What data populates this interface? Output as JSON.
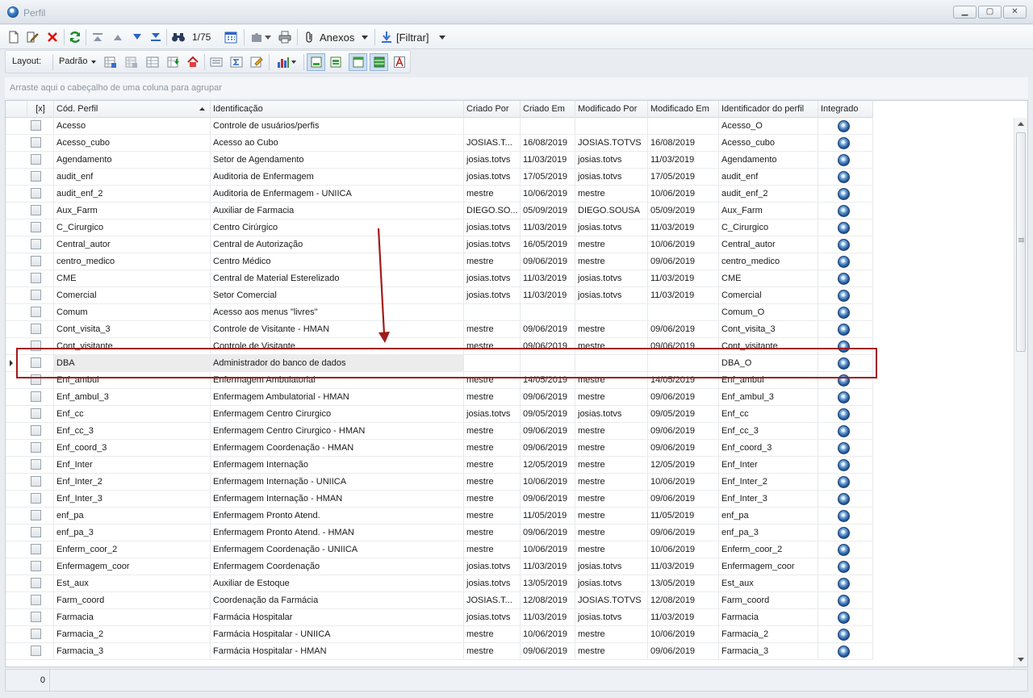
{
  "window": {
    "title": "Perfil",
    "minimize_label": "▁",
    "maximize_label": "▢",
    "close_label": "✕"
  },
  "toolbar": {
    "record_counter": "1/75",
    "attachments_label": "Anexos",
    "filter_label": "[Filtrar]"
  },
  "layout_bar": {
    "layout_label": "Layout:",
    "preset_label": "Padrão"
  },
  "group_panel": {
    "hint": "Arraste aqui o cabeçalho de uma coluna para agrupar"
  },
  "grid": {
    "columns": [
      "[x]",
      "Cód. Perfil",
      "Identificação",
      "Criado Por",
      "Criado Em",
      "Modificado Por",
      "Modificado Em",
      "Identificador do perfil",
      "Integrado"
    ],
    "sorted_column": "Cód. Perfil",
    "selected_row": 14,
    "rows": [
      [
        "Acesso",
        "Controle de usuários/perfis",
        "",
        "",
        "",
        "",
        "Acesso_O"
      ],
      [
        "Acesso_cubo",
        "Acesso ao Cubo",
        "JOSIAS.T...",
        "16/08/2019",
        "JOSIAS.TOTVS",
        "16/08/2019",
        "Acesso_cubo"
      ],
      [
        "Agendamento",
        "Setor de Agendamento",
        "josias.totvs",
        "11/03/2019",
        "josias.totvs",
        "11/03/2019",
        "Agendamento"
      ],
      [
        "audit_enf",
        "Auditoria de Enfermagem",
        "josias.totvs",
        "17/05/2019",
        "josias.totvs",
        "17/05/2019",
        "audit_enf"
      ],
      [
        "audit_enf_2",
        "Auditoria de Enfermagem  - UNIICA",
        "mestre",
        "10/06/2019",
        "mestre",
        "10/06/2019",
        "audit_enf_2"
      ],
      [
        "Aux_Farm",
        "Auxiliar de Farmacia",
        "DIEGO.SO...",
        "05/09/2019",
        "DIEGO.SOUSA",
        "05/09/2019",
        "Aux_Farm"
      ],
      [
        "C_Cirurgico",
        "Centro Cirúrgico",
        "josias.totvs",
        "11/03/2019",
        "josias.totvs",
        "11/03/2019",
        "C_Cirurgico"
      ],
      [
        "Central_autor",
        "Central de Autorização",
        "josias.totvs",
        "16/05/2019",
        "mestre",
        "10/06/2019",
        "Central_autor"
      ],
      [
        "centro_medico",
        "Centro Médico",
        "mestre",
        "09/06/2019",
        "mestre",
        "09/06/2019",
        "centro_medico"
      ],
      [
        "CME",
        "Central de Material Esterelizado",
        "josias.totvs",
        "11/03/2019",
        "josias.totvs",
        "11/03/2019",
        "CME"
      ],
      [
        "Comercial",
        "Setor Comercial",
        "josias.totvs",
        "11/03/2019",
        "josias.totvs",
        "11/03/2019",
        "Comercial"
      ],
      [
        "Comum",
        "Acesso aos menus \"livres\"",
        "",
        "",
        "",
        "",
        "Comum_O"
      ],
      [
        "Cont_visita_3",
        "Controle de Visitante - HMAN",
        "mestre",
        "09/06/2019",
        "mestre",
        "09/06/2019",
        "Cont_visita_3"
      ],
      [
        "Cont_visitante",
        "Controle de Visitante",
        "mestre",
        "09/06/2019",
        "mestre",
        "09/06/2019",
        "Cont_visitante"
      ],
      [
        "DBA",
        "Administrador do banco de dados",
        "",
        "",
        "",
        "",
        "DBA_O"
      ],
      [
        "Enf_ambul",
        "Enfermagem Ambulatorial",
        "mestre",
        "14/05/2019",
        "mestre",
        "14/05/2019",
        "Enf_ambul"
      ],
      [
        "Enf_ambul_3",
        "Enfermagem Ambulatorial - HMAN",
        "mestre",
        "09/06/2019",
        "mestre",
        "09/06/2019",
        "Enf_ambul_3"
      ],
      [
        "Enf_cc",
        "Enfermagem Centro Cirurgico",
        "josias.totvs",
        "09/05/2019",
        "josias.totvs",
        "09/05/2019",
        "Enf_cc"
      ],
      [
        "Enf_cc_3",
        "Enfermagem Centro Cirurgico - HMAN",
        "mestre",
        "09/06/2019",
        "mestre",
        "09/06/2019",
        "Enf_cc_3"
      ],
      [
        "Enf_coord_3",
        "Enfermagem Coordenação - HMAN",
        "mestre",
        "09/06/2019",
        "mestre",
        "09/06/2019",
        "Enf_coord_3"
      ],
      [
        "Enf_Inter",
        "Enfermagem Internação",
        "mestre",
        "12/05/2019",
        "mestre",
        "12/05/2019",
        "Enf_Inter"
      ],
      [
        "Enf_Inter_2",
        "Enfermagem Internação  - UNIICA",
        "mestre",
        "10/06/2019",
        "mestre",
        "10/06/2019",
        "Enf_Inter_2"
      ],
      [
        "Enf_Inter_3",
        "Enfermagem Internação - HMAN",
        "mestre",
        "09/06/2019",
        "mestre",
        "09/06/2019",
        "Enf_Inter_3"
      ],
      [
        "enf_pa",
        "Enfermagem Pronto Atend.",
        "mestre",
        "11/05/2019",
        "mestre",
        "11/05/2019",
        "enf_pa"
      ],
      [
        "enf_pa_3",
        "Enfermagem Pronto Atend. - HMAN",
        "mestre",
        "09/06/2019",
        "mestre",
        "09/06/2019",
        "enf_pa_3"
      ],
      [
        "Enferm_coor_2",
        "Enfermagem Coordenação  - UNIICA",
        "mestre",
        "10/06/2019",
        "mestre",
        "10/06/2019",
        "Enferm_coor_2"
      ],
      [
        "Enfermagem_coor",
        "Enfermagem Coordenação",
        "josias.totvs",
        "11/03/2019",
        "josias.totvs",
        "11/03/2019",
        "Enfermagem_coor"
      ],
      [
        "Est_aux",
        "Auxiliar de Estoque",
        "josias.totvs",
        "13/05/2019",
        "josias.totvs",
        "13/05/2019",
        "Est_aux"
      ],
      [
        "Farm_coord",
        "Coordenação da Farmácia",
        "JOSIAS.T...",
        "12/08/2019",
        "JOSIAS.TOTVS",
        "12/08/2019",
        "Farm_coord"
      ],
      [
        "Farmacia",
        "Farmácia Hospitalar",
        "josias.totvs",
        "11/03/2019",
        "josias.totvs",
        "11/03/2019",
        "Farmacia"
      ],
      [
        "Farmacia_2",
        "Farmácia Hospitalar  - UNIICA",
        "mestre",
        "10/06/2019",
        "mestre",
        "10/06/2019",
        "Farmacia_2"
      ],
      [
        "Farmacia_3",
        "Farmácia Hospitalar - HMAN",
        "mestre",
        "09/06/2019",
        "mestre",
        "09/06/2019",
        "Farmacia_3"
      ]
    ]
  },
  "footer": {
    "selected_count": "0"
  },
  "colors": {
    "annotation": "#a11b1b",
    "selected_cell": "#ececec"
  }
}
